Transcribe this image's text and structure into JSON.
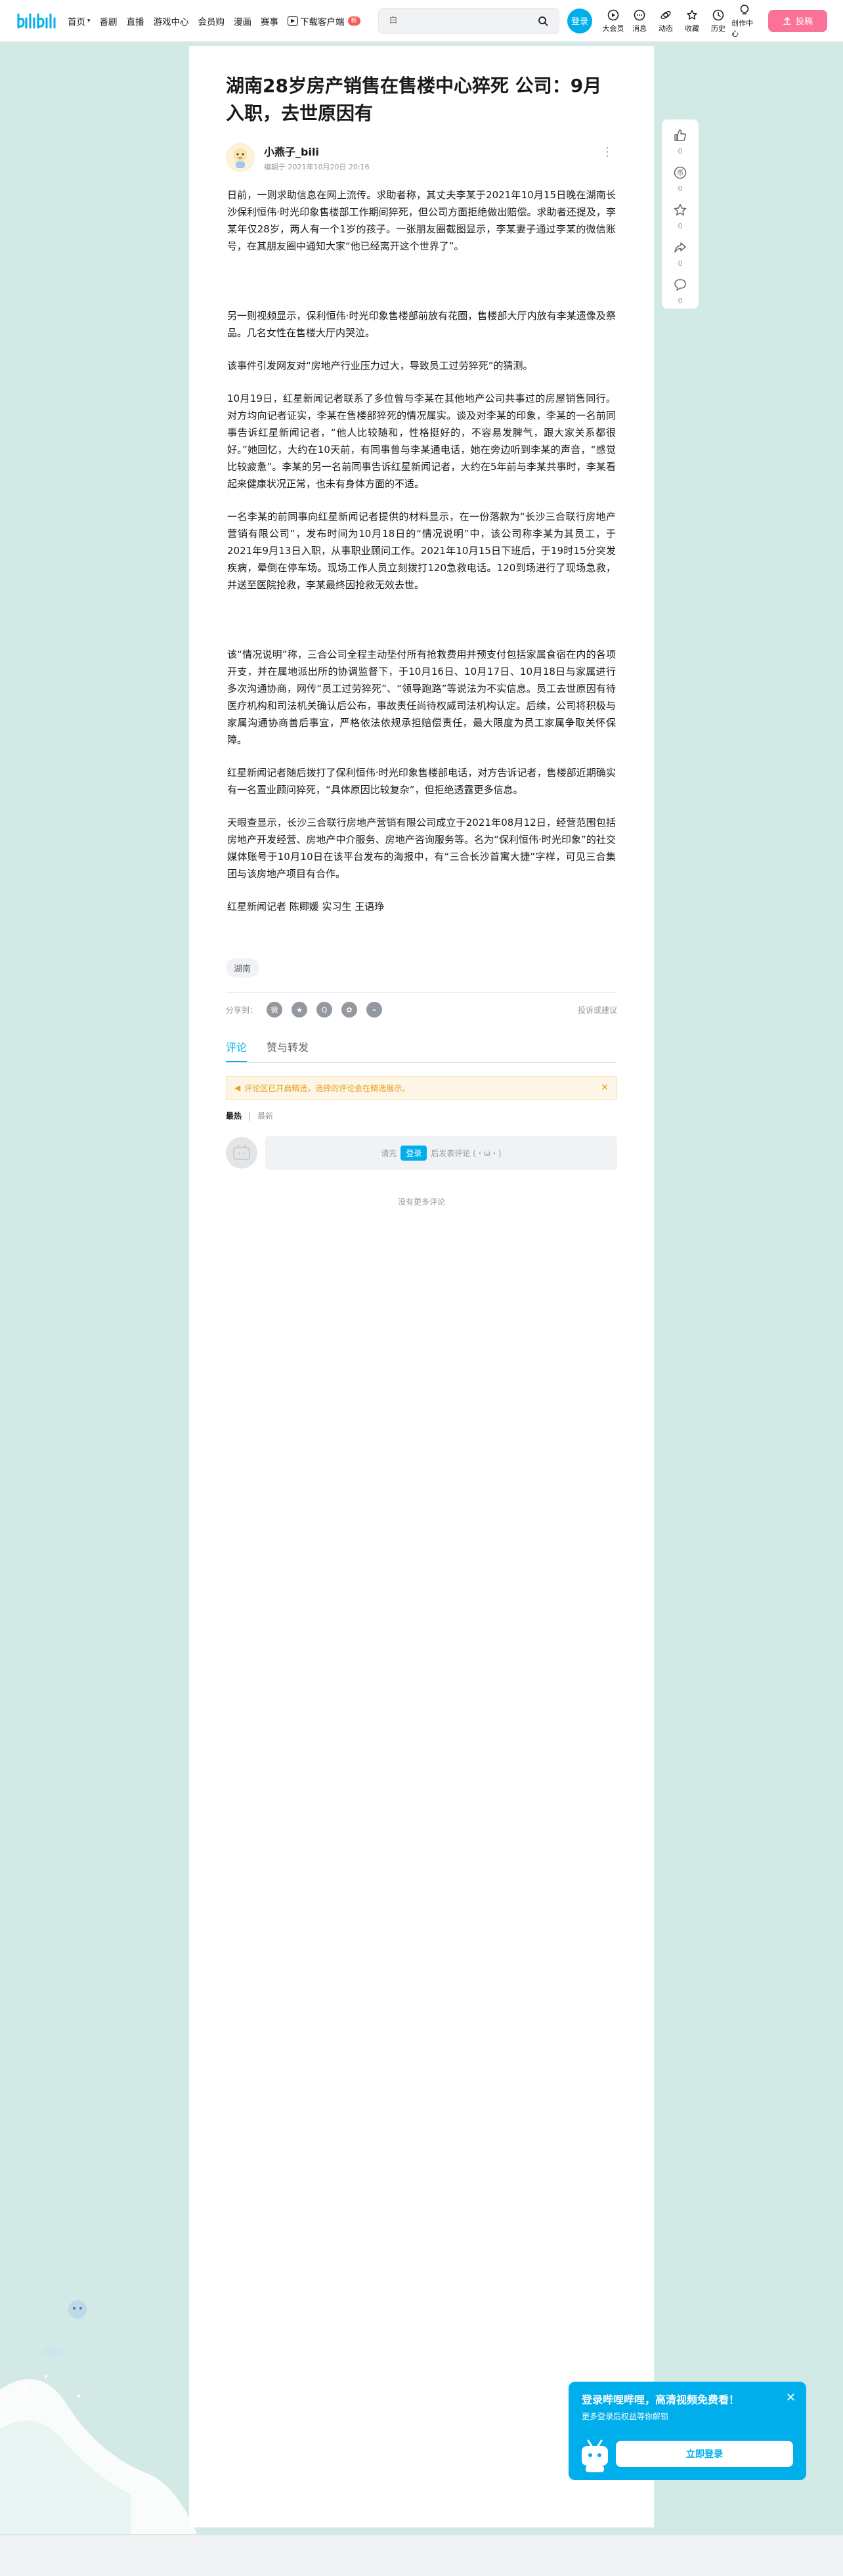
{
  "header": {
    "nav": [
      {
        "label": "首页",
        "has_arrow": true
      },
      {
        "label": "番剧"
      },
      {
        "label": "直播"
      },
      {
        "label": "游戏中心"
      },
      {
        "label": "会员购"
      },
      {
        "label": "漫画"
      },
      {
        "label": "赛事"
      }
    ],
    "download": {
      "label": "下载客户端",
      "badge": "新"
    },
    "search_placeholder": "白",
    "login_label": "登录",
    "right_entries": [
      {
        "label": "大会员",
        "icon": "tv-icon"
      },
      {
        "label": "消息",
        "icon": "message-icon"
      },
      {
        "label": "动态",
        "icon": "dynamic-icon"
      },
      {
        "label": "收藏",
        "icon": "star-icon"
      },
      {
        "label": "历史",
        "icon": "history-icon"
      },
      {
        "label": "创作中心",
        "icon": "bulb-icon"
      }
    ],
    "upload_label": "投稿"
  },
  "article": {
    "title": "湖南28岁房产销售在售楼中心猝死 公司：9月入职，去世原因有",
    "author": {
      "name": "小燕子_bili",
      "meta": "编辑于 2021年10月20日 20:16"
    },
    "paragraphs": [
      "日前，一则求助信息在网上流传。求助者称，其丈夫李某于2021年10月15日晚在湖南长沙保利恒伟·时光印象售楼部工作期间猝死，但公司方面拒绝做出赔偿。求助者还提及，李某年仅28岁，两人有一个1岁的孩子。一张朋友圈截图显示，李某妻子通过李某的微信账号，在其朋友圈中通知大家“他已经离开这个世界了”。",
      "另一则视频显示，保利恒伟·时光印象售楼部前放有花圈，售楼部大厅内放有李某遗像及祭品。几名女性在售楼大厅内哭泣。",
      "该事件引发网友对“房地产行业压力过大，导致员工过劳猝死”的猜测。",
      "10月19日，红星新闻记者联系了多位曾与李某在其他地产公司共事过的房屋销售同行。对方均向记者证实，李某在售楼部猝死的情况属实。谈及对李某的印象，李某的一名前同事告诉红星新闻记者，“他人比较随和，性格挺好的，不容易发脾气，跟大家关系都很好。”她回忆，大约在10天前，有同事曾与李某通电话，她在旁边听到李某的声音，“感觉比较疲惫”。李某的另一名前同事告诉红星新闻记者，大约在5年前与李某共事时，李某看起来健康状况正常，也未有身体方面的不适。",
      "一名李某的前同事向红星新闻记者提供的材料显示，在一份落款为“长沙三合联行房地产营销有限公司”，发布时间为10月18日的“情况说明”中，该公司称李某为其员工，于2021年9月13日入职，从事职业顾问工作。2021年10月15日下班后，于19时15分突发疾病，晕倒在停车场。现场工作人员立刻拨打120急救电话。120到场进行了现场急救，并送至医院抢救，李某最终因抢救无效去世。",
      "该“情况说明”称，三合公司全程主动垫付所有抢救费用并预支付包括家属食宿在内的各项开支，并在属地派出所的协调监督下，于10月16日、10月17日、10月18日与家属进行多次沟通协商，网传“员工过劳猝死”、“领导跑路”等说法为不实信息。员工去世原因有待医疗机构和司法机关确认后公布，事故责任尚待权威司法机构认定。后续，公司将积极与家属沟通协商善后事宜，严格依法依规承担赔偿责任，最大限度为员工家属争取关怀保障。",
      "红星新闻记者随后拨打了保利恒伟·时光印象售楼部电话，对方告诉记者，售楼部近期确实有一名置业顾问猝死，“具体原因比较复杂”，但拒绝透露更多信息。",
      "天眼查显示，长沙三合联行房地产营销有限公司成立于2021年08月12日，经营范围包括房地产开发经营、房地产中介服务、房地产咨询服务等。名为“保利恒伟·时光印象”的社交媒体账号于10月10日在该平台发布的海报中，有“三合长沙首寓大捷”字样，可见三合集团与该房地产项目有合作。",
      "红星新闻记者 陈卿媛 实习生 王语琤"
    ],
    "tag": "湖南",
    "share_label": "分享到：",
    "share_icons": [
      "weibo-icon",
      "qzone-icon",
      "qq-icon",
      "wechat-icon",
      "link-icon"
    ],
    "report_label": "投诉或建议"
  },
  "comments": {
    "tabs": [
      "评论",
      "赞与转发"
    ],
    "notice": "评论区已开启精选，选择的评论会在精选展示。",
    "sort": {
      "hot": "最热",
      "new": "最新"
    },
    "input_prefix": "请先",
    "input_login": "登录",
    "input_suffix": "后发表评论 (・ω・)",
    "no_more": "没有更多评论"
  },
  "side_toolbar": [
    {
      "icon": "like-icon",
      "count": "0"
    },
    {
      "icon": "coin-icon",
      "count": "0"
    },
    {
      "icon": "favorite-icon",
      "count": "0"
    },
    {
      "icon": "share-icon",
      "count": "0"
    },
    {
      "icon": "comment-icon",
      "count": "0"
    }
  ],
  "login_popup": {
    "title": "登录哔哩哔哩，高清视频免费看！",
    "subtitle": "更多登录后权益等你解锁",
    "button": "立即登录"
  },
  "colors": {
    "brand_blue": "#00aeec",
    "brand_pink": "#fb7299",
    "background": "#d3e9e5"
  }
}
